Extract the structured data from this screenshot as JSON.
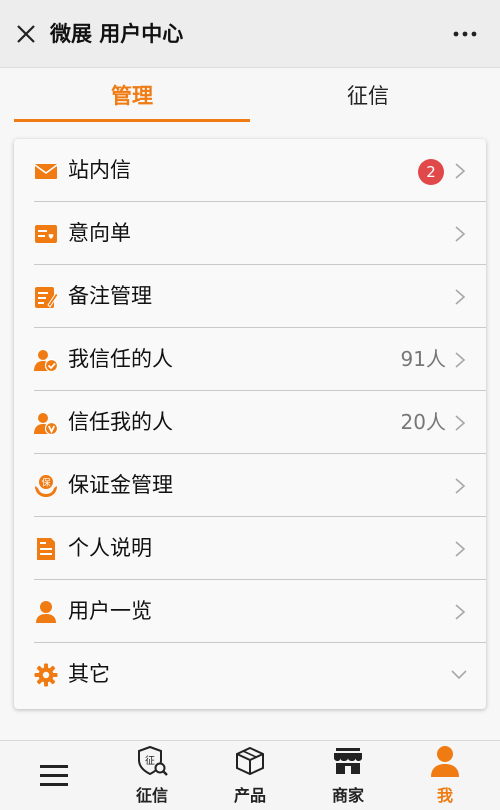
{
  "window": {
    "title": "微展 用户中心",
    "close_icon": "close-icon",
    "more_icon": "more-icon"
  },
  "tabs": [
    {
      "label": "管理",
      "active": true
    },
    {
      "label": "征信",
      "active": false
    }
  ],
  "menu": [
    {
      "label": "站内信",
      "icon": "envelope-icon",
      "badge": "2"
    },
    {
      "label": "意向单",
      "icon": "order-icon"
    },
    {
      "label": "备注管理",
      "icon": "note-icon"
    },
    {
      "label": "我信任的人",
      "icon": "user-check-icon",
      "count": "91人"
    },
    {
      "label": "信任我的人",
      "icon": "user-v-icon",
      "count": "20人"
    },
    {
      "label": "保证金管理",
      "icon": "deposit-icon"
    },
    {
      "label": "个人说明",
      "icon": "document-icon"
    },
    {
      "label": "用户一览",
      "icon": "user-icon"
    },
    {
      "label": "其它",
      "icon": "gear-icon"
    }
  ],
  "bottom_nav": {
    "menu_icon": "hamburger-icon",
    "items": [
      {
        "label": "征信",
        "icon": "credit-icon"
      },
      {
        "label": "产品",
        "icon": "box-icon"
      },
      {
        "label": "商家",
        "icon": "store-icon"
      },
      {
        "label": "我",
        "icon": "person-icon",
        "active": true
      }
    ]
  },
  "colors": {
    "accent": "#f07b12",
    "badge": "#e0484a"
  }
}
